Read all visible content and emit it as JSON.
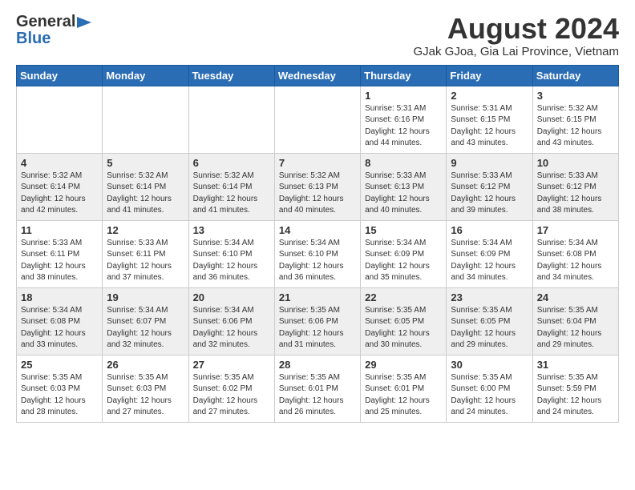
{
  "logo": {
    "general": "General",
    "blue": "Blue"
  },
  "title": {
    "month_year": "August 2024",
    "location": "GJak GJoa, Gia Lai Province, Vietnam"
  },
  "days_of_week": [
    "Sunday",
    "Monday",
    "Tuesday",
    "Wednesday",
    "Thursday",
    "Friday",
    "Saturday"
  ],
  "weeks": [
    [
      {
        "day": "",
        "info": ""
      },
      {
        "day": "",
        "info": ""
      },
      {
        "day": "",
        "info": ""
      },
      {
        "day": "",
        "info": ""
      },
      {
        "day": "1",
        "info": "Sunrise: 5:31 AM\nSunset: 6:16 PM\nDaylight: 12 hours\nand 44 minutes."
      },
      {
        "day": "2",
        "info": "Sunrise: 5:31 AM\nSunset: 6:15 PM\nDaylight: 12 hours\nand 43 minutes."
      },
      {
        "day": "3",
        "info": "Sunrise: 5:32 AM\nSunset: 6:15 PM\nDaylight: 12 hours\nand 43 minutes."
      }
    ],
    [
      {
        "day": "4",
        "info": "Sunrise: 5:32 AM\nSunset: 6:14 PM\nDaylight: 12 hours\nand 42 minutes."
      },
      {
        "day": "5",
        "info": "Sunrise: 5:32 AM\nSunset: 6:14 PM\nDaylight: 12 hours\nand 41 minutes."
      },
      {
        "day": "6",
        "info": "Sunrise: 5:32 AM\nSunset: 6:14 PM\nDaylight: 12 hours\nand 41 minutes."
      },
      {
        "day": "7",
        "info": "Sunrise: 5:32 AM\nSunset: 6:13 PM\nDaylight: 12 hours\nand 40 minutes."
      },
      {
        "day": "8",
        "info": "Sunrise: 5:33 AM\nSunset: 6:13 PM\nDaylight: 12 hours\nand 40 minutes."
      },
      {
        "day": "9",
        "info": "Sunrise: 5:33 AM\nSunset: 6:12 PM\nDaylight: 12 hours\nand 39 minutes."
      },
      {
        "day": "10",
        "info": "Sunrise: 5:33 AM\nSunset: 6:12 PM\nDaylight: 12 hours\nand 38 minutes."
      }
    ],
    [
      {
        "day": "11",
        "info": "Sunrise: 5:33 AM\nSunset: 6:11 PM\nDaylight: 12 hours\nand 38 minutes."
      },
      {
        "day": "12",
        "info": "Sunrise: 5:33 AM\nSunset: 6:11 PM\nDaylight: 12 hours\nand 37 minutes."
      },
      {
        "day": "13",
        "info": "Sunrise: 5:34 AM\nSunset: 6:10 PM\nDaylight: 12 hours\nand 36 minutes."
      },
      {
        "day": "14",
        "info": "Sunrise: 5:34 AM\nSunset: 6:10 PM\nDaylight: 12 hours\nand 36 minutes."
      },
      {
        "day": "15",
        "info": "Sunrise: 5:34 AM\nSunset: 6:09 PM\nDaylight: 12 hours\nand 35 minutes."
      },
      {
        "day": "16",
        "info": "Sunrise: 5:34 AM\nSunset: 6:09 PM\nDaylight: 12 hours\nand 34 minutes."
      },
      {
        "day": "17",
        "info": "Sunrise: 5:34 AM\nSunset: 6:08 PM\nDaylight: 12 hours\nand 34 minutes."
      }
    ],
    [
      {
        "day": "18",
        "info": "Sunrise: 5:34 AM\nSunset: 6:08 PM\nDaylight: 12 hours\nand 33 minutes."
      },
      {
        "day": "19",
        "info": "Sunrise: 5:34 AM\nSunset: 6:07 PM\nDaylight: 12 hours\nand 32 minutes."
      },
      {
        "day": "20",
        "info": "Sunrise: 5:34 AM\nSunset: 6:06 PM\nDaylight: 12 hours\nand 32 minutes."
      },
      {
        "day": "21",
        "info": "Sunrise: 5:35 AM\nSunset: 6:06 PM\nDaylight: 12 hours\nand 31 minutes."
      },
      {
        "day": "22",
        "info": "Sunrise: 5:35 AM\nSunset: 6:05 PM\nDaylight: 12 hours\nand 30 minutes."
      },
      {
        "day": "23",
        "info": "Sunrise: 5:35 AM\nSunset: 6:05 PM\nDaylight: 12 hours\nand 29 minutes."
      },
      {
        "day": "24",
        "info": "Sunrise: 5:35 AM\nSunset: 6:04 PM\nDaylight: 12 hours\nand 29 minutes."
      }
    ],
    [
      {
        "day": "25",
        "info": "Sunrise: 5:35 AM\nSunset: 6:03 PM\nDaylight: 12 hours\nand 28 minutes."
      },
      {
        "day": "26",
        "info": "Sunrise: 5:35 AM\nSunset: 6:03 PM\nDaylight: 12 hours\nand 27 minutes."
      },
      {
        "day": "27",
        "info": "Sunrise: 5:35 AM\nSunset: 6:02 PM\nDaylight: 12 hours\nand 27 minutes."
      },
      {
        "day": "28",
        "info": "Sunrise: 5:35 AM\nSunset: 6:01 PM\nDaylight: 12 hours\nand 26 minutes."
      },
      {
        "day": "29",
        "info": "Sunrise: 5:35 AM\nSunset: 6:01 PM\nDaylight: 12 hours\nand 25 minutes."
      },
      {
        "day": "30",
        "info": "Sunrise: 5:35 AM\nSunset: 6:00 PM\nDaylight: 12 hours\nand 24 minutes."
      },
      {
        "day": "31",
        "info": "Sunrise: 5:35 AM\nSunset: 5:59 PM\nDaylight: 12 hours\nand 24 minutes."
      }
    ]
  ]
}
